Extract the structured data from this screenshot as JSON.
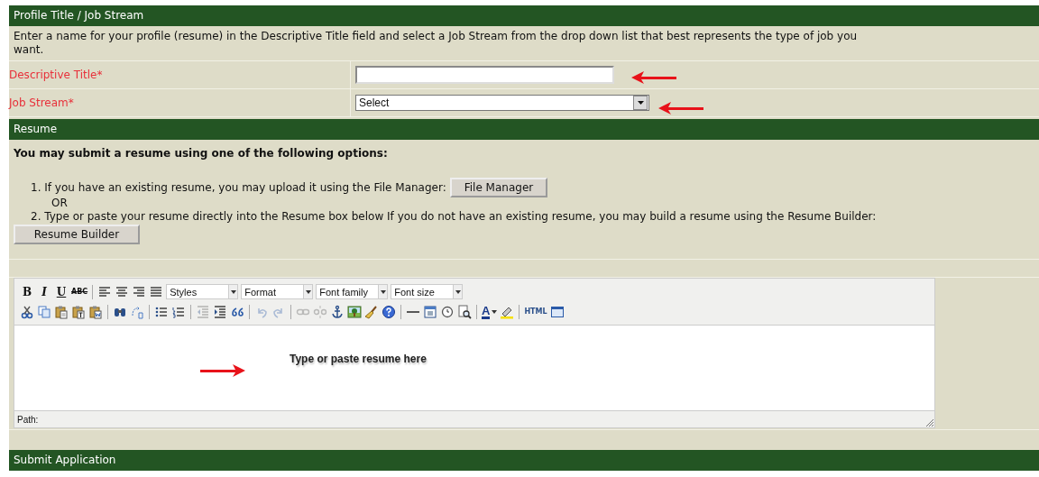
{
  "profile_section": {
    "title": "Profile Title / Job Stream",
    "instructions": "Enter a name for your profile (resume) in the Descriptive Title field and select a Job Stream from the drop down list that best represents the type of job you want.",
    "fields": [
      {
        "kind": "text",
        "label": "Descriptive Title*"
      },
      {
        "kind": "select",
        "label": "Job Stream*",
        "value": "Select"
      }
    ]
  },
  "resume_section": {
    "title": "Resume",
    "heading": "You may submit a resume using one of the following options:",
    "option_1": "1. If you have an existing resume, you may upload it using the File Manager:",
    "option_1_button": "File Manager",
    "separator": "OR",
    "option_2": "2. Type or paste your resume directly into the Resume box below If you do not have an existing resume, you may build a resume using the Resume Builder:",
    "option_2_button": "Resume Builder"
  },
  "editor": {
    "toolbar_rows": [
      [
        {
          "kind": "text",
          "label": "B"
        },
        {
          "kind": "text",
          "label": "I"
        },
        {
          "kind": "text",
          "label": "U"
        },
        {
          "kind": "text",
          "label": "ABC"
        },
        {
          "kind": "sep"
        },
        {
          "kind": "icon",
          "disabled": false
        },
        {
          "kind": "icon",
          "disabled": false
        },
        {
          "kind": "icon",
          "disabled": false
        },
        {
          "kind": "icon",
          "disabled": false
        },
        {
          "kind": "select",
          "label": "Styles"
        },
        {
          "kind": "select",
          "label": "Format"
        },
        {
          "kind": "select",
          "label": "Font family"
        },
        {
          "kind": "select",
          "label": "Font size"
        }
      ],
      [
        {
          "kind": "icon",
          "disabled": false
        },
        {
          "kind": "icon",
          "disabled": false
        },
        {
          "kind": "icon",
          "disabled": false
        },
        {
          "kind": "icon",
          "disabled": false
        },
        {
          "kind": "icon",
          "disabled": false
        },
        {
          "kind": "sep"
        },
        {
          "kind": "icon",
          "disabled": false
        },
        {
          "kind": "icon",
          "disabled": false
        },
        {
          "kind": "sep"
        },
        {
          "kind": "icon",
          "disabled": false
        },
        {
          "kind": "icon",
          "disabled": false
        },
        {
          "kind": "sep"
        },
        {
          "kind": "icon",
          "disabled": true
        },
        {
          "kind": "icon",
          "disabled": false
        },
        {
          "kind": "icon",
          "disabled": false
        },
        {
          "kind": "sep"
        },
        {
          "kind": "icon",
          "disabled": true
        },
        {
          "kind": "icon",
          "disabled": true
        },
        {
          "kind": "sep"
        },
        {
          "kind": "icon",
          "disabled": true
        },
        {
          "kind": "icon",
          "disabled": true
        },
        {
          "kind": "icon",
          "disabled": false
        },
        {
          "kind": "icon",
          "disabled": false
        },
        {
          "kind": "icon",
          "disabled": false
        },
        {
          "kind": "icon",
          "disabled": false
        },
        {
          "kind": "sep"
        },
        {
          "kind": "icon",
          "disabled": false
        },
        {
          "kind": "icon",
          "disabled": false
        },
        {
          "kind": "icon",
          "disabled": false
        },
        {
          "kind": "icon",
          "disabled": false
        },
        {
          "kind": "sep"
        },
        {
          "kind": "color",
          "label": "A"
        },
        {
          "kind": "icon",
          "disabled": false
        },
        {
          "kind": "sep"
        },
        {
          "kind": "text",
          "label": "HTML"
        },
        {
          "kind": "icon",
          "disabled": false
        }
      ]
    ],
    "placeholder": "Type or paste resume here",
    "path_label": "Path:"
  },
  "submit_section": {
    "title": "Submit Application"
  }
}
